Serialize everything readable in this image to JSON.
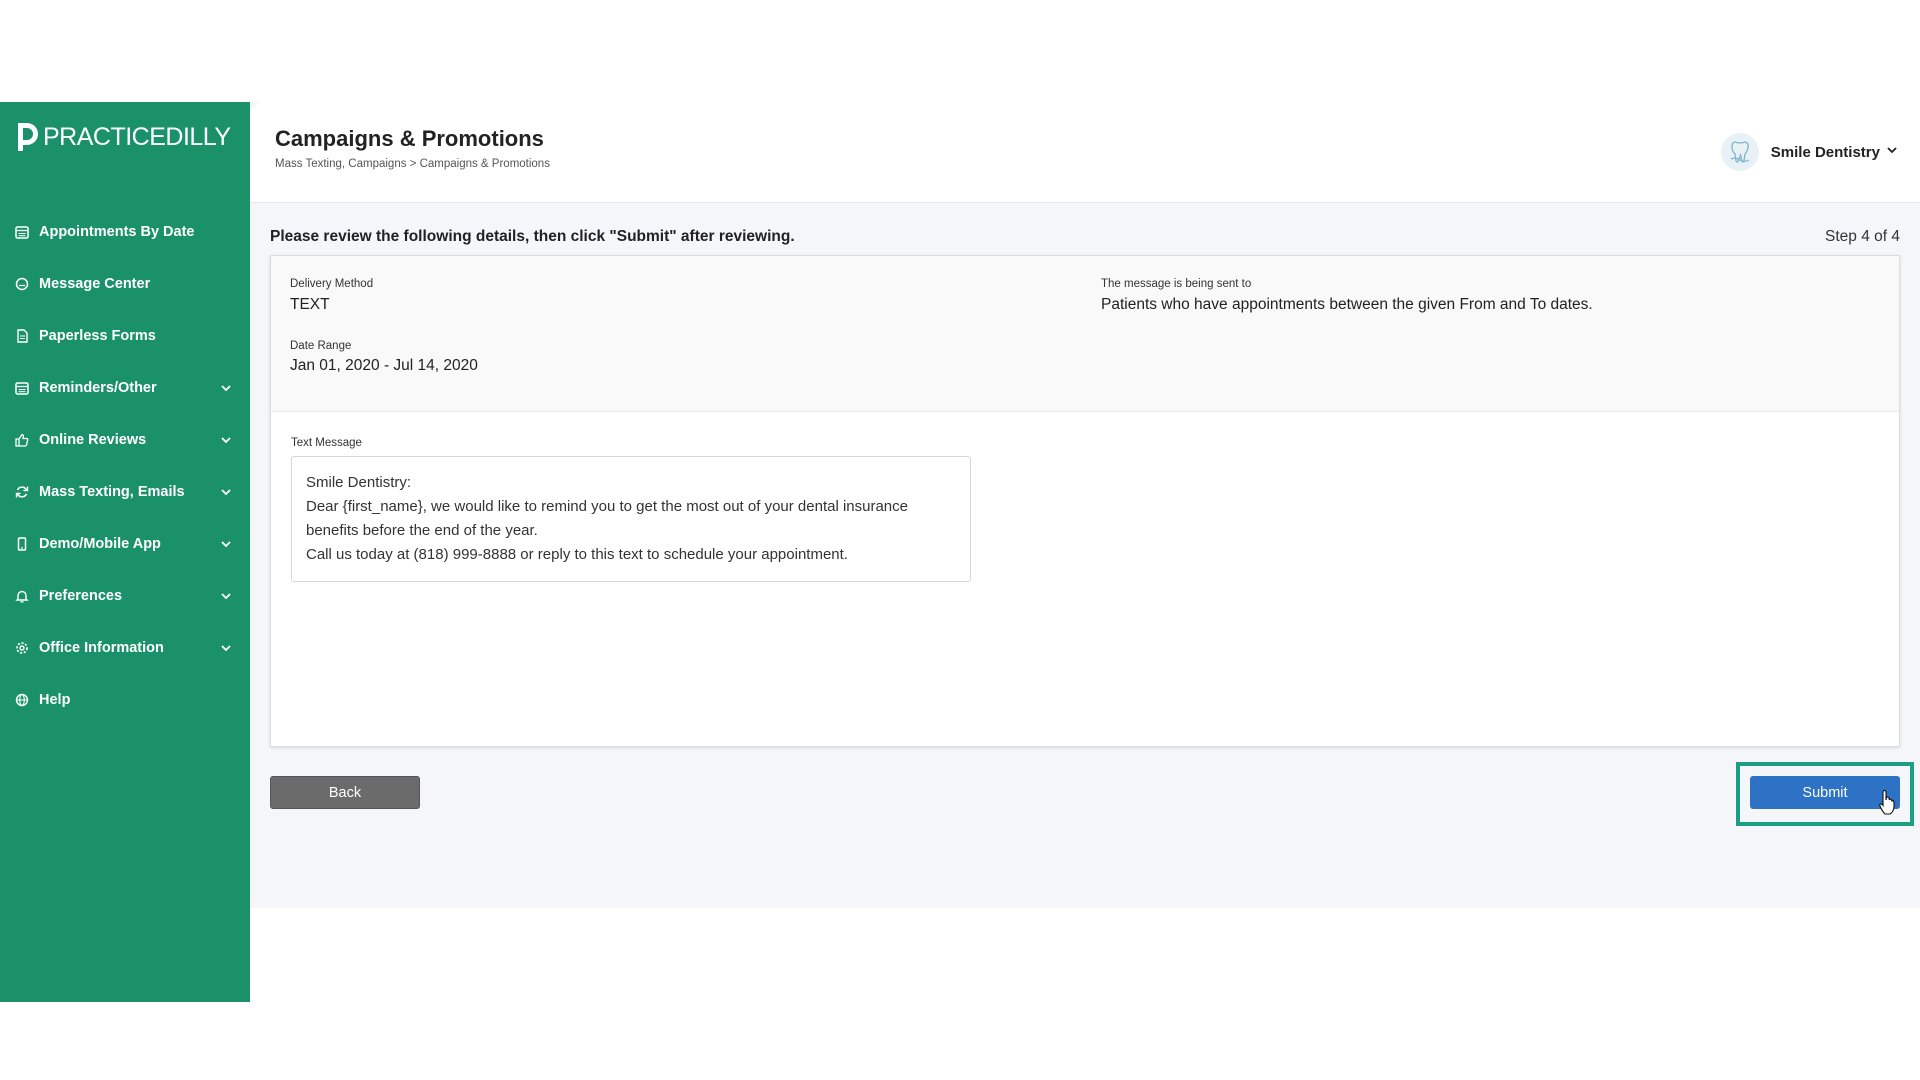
{
  "brand": {
    "name": "PRACTICEDILLY"
  },
  "colors": {
    "sidebar": "#1b9169",
    "submit": "#2d72c4",
    "back": "#6b6b6b",
    "highlight": "#1b9e84"
  },
  "sidebar": {
    "items": [
      {
        "label": "Appointments By Date",
        "icon": "calendar-icon",
        "expandable": false
      },
      {
        "label": "Message Center",
        "icon": "chat-icon",
        "expandable": false
      },
      {
        "label": "Paperless Forms",
        "icon": "document-icon",
        "expandable": false
      },
      {
        "label": "Reminders/Other",
        "icon": "calendar-icon",
        "expandable": true
      },
      {
        "label": "Online Reviews",
        "icon": "thumbs-up-icon",
        "expandable": true
      },
      {
        "label": "Mass Texting, Emails",
        "icon": "refresh-icon",
        "expandable": true
      },
      {
        "label": "Demo/Mobile App",
        "icon": "mobile-icon",
        "expandable": true
      },
      {
        "label": "Preferences",
        "icon": "bell-icon",
        "expandable": true
      },
      {
        "label": "Office Information",
        "icon": "gear-icon",
        "expandable": true
      },
      {
        "label": "Help",
        "icon": "globe-icon",
        "expandable": false
      }
    ]
  },
  "header": {
    "title": "Campaigns & Promotions",
    "breadcrumb": "Mass Texting, Campaigns > Campaigns & Promotions",
    "user_name": "Smile Dentistry"
  },
  "review": {
    "instruction": "Please review the following details, then click \"Submit\" after reviewing.",
    "step": "Step 4 of 4",
    "delivery_method_label": "Delivery Method",
    "delivery_method": "TEXT",
    "recipients_label": "The message is being sent to",
    "recipients": "Patients who have appointments between the given From and To dates.",
    "date_range_label": "Date Range",
    "date_range": "Jan 01, 2020 - Jul 14, 2020",
    "text_message_label": "Text Message",
    "message_lines": [
      "Smile Dentistry:",
      "Dear {first_name}, we would like to remind you to get the most out of your dental insurance",
      "benefits before the end of the year.",
      "Call us today at (818) 999-8888 or reply to this text to schedule your appointment."
    ]
  },
  "buttons": {
    "back": "Back",
    "submit": "Submit"
  }
}
